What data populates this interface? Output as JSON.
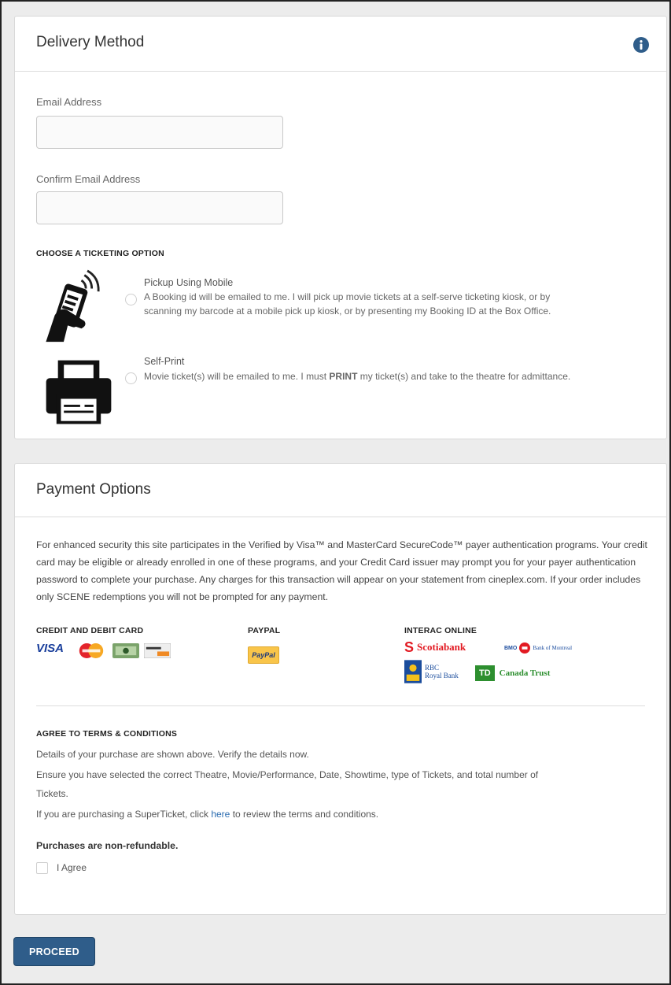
{
  "delivery": {
    "title": "Delivery Method",
    "email_label": "Email Address",
    "email_value": "",
    "confirm_label": "Confirm Email Address",
    "confirm_value": "",
    "ticketing_heading": "CHOOSE A TICKETING OPTION",
    "options": [
      {
        "title": "Pickup Using Mobile",
        "line1": "A Booking id will be emailed to me. I will pick up movie tickets at a self-serve ticketing kiosk, or by",
        "line2": "scanning my barcode at a mobile pick up kiosk, or by presenting my Booking ID at the Box Office.",
        "icon": "mobile-phone-icon",
        "selected": false
      },
      {
        "title": "Self-Print",
        "desc_pre": "Movie ticket(s) will be emailed to me. I must ",
        "desc_bold": "PRINT",
        "desc_post": " my ticket(s) and take to the theatre for admittance.",
        "icon": "printer-icon",
        "selected": false
      }
    ]
  },
  "payment": {
    "title": "Payment Options",
    "security_text": "For enhanced security this site participates in the Verified by Visa™ and MasterCard SecureCode™ payer authentication programs. Your credit card may be eligible or already enrolled in one of these programs, and your Credit Card issuer may prompt you for your payer authentication password to complete your purchase. Any charges for this transaction will appear on your statement from cineplex.com. If your order includes only SCENE redemptions you will not be prompted for any payment.",
    "methods": {
      "credit_heading": "CREDIT AND DEBIT CARD",
      "paypal_heading": "PAYPAL",
      "interac_heading": "INTERAC ONLINE",
      "visa": "VISA",
      "paypal": "PayPal",
      "scotiabank": "Scotiabank",
      "bmo": "BMO",
      "bmo_full": "Bank of Montreal",
      "rbc": "RBC",
      "rbc_full": "Royal Bank",
      "td": "TD",
      "td_full": "Canada Trust"
    },
    "terms": {
      "heading": "AGREE TO TERMS & CONDITIONS",
      "line1": "Details of your purchase are shown above. Verify the details now.",
      "line2": "Ensure you have selected the correct Theatre, Movie/Performance, Date, Showtime, type of Tickets, and total number of",
      "line3": "Tickets.",
      "line4_pre": "If you are purchasing a SuperTicket, click ",
      "line4_link": "here",
      "line4_post": " to review the terms and conditions.",
      "non_refundable": "Purchases are non-refundable.",
      "agree_label": "I Agree",
      "agreed": false
    }
  },
  "proceed_label": "PROCEED",
  "colors": {
    "info_icon": "#2f5d8a",
    "proceed_bg": "#2f5d8a",
    "link": "#2b6cb0",
    "scotia_red": "#e21a22",
    "td_green": "#2d8f2f"
  }
}
